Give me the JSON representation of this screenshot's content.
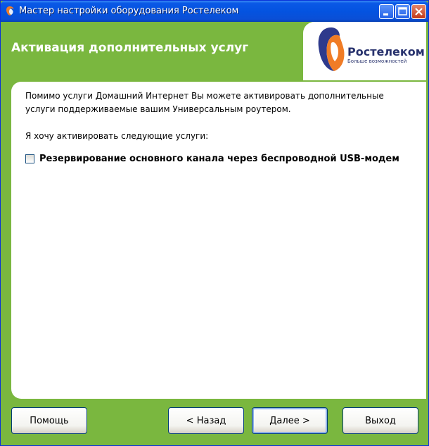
{
  "window": {
    "title": "Мастер настройки оборудования Ростелеком",
    "controls": [
      "minimize-icon",
      "maximize-icon",
      "close-icon"
    ]
  },
  "header": {
    "heading": "Активация дополнительных услуг",
    "logo": {
      "name": "Ростелеком",
      "tagline": "Больше возможностей"
    }
  },
  "content": {
    "intro": "Помимо услуги Домашний Интернет Вы можете активировать дополнительные услуги поддерживаемые вашим Универсальным роутером.",
    "prompt": "Я хочу активировать следующие услуги:",
    "options": [
      {
        "label": "Резервирование основного канала через беспроводной USB-модем",
        "checked": false
      }
    ]
  },
  "buttons": {
    "help": "Помощь",
    "back": "< Назад",
    "next": "Далее >",
    "exit": "Выход"
  },
  "colors": {
    "header_green": "#7ab73f",
    "titlebar_blue": "#0453e0",
    "brand_blue": "#29336e",
    "brand_orange": "#f07c26"
  }
}
